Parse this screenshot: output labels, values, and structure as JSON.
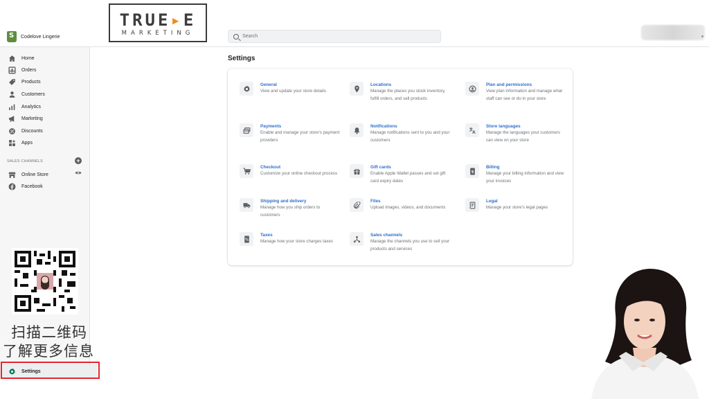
{
  "store": {
    "name": "Codelove Lingerie"
  },
  "brand": {
    "main_a": "TRUE",
    "main_b": "E",
    "sub": "MARKETING"
  },
  "search": {
    "placeholder": "Search"
  },
  "sidebar": {
    "items": [
      {
        "label": "Home",
        "icon": "home-icon"
      },
      {
        "label": "Orders",
        "icon": "orders-icon"
      },
      {
        "label": "Products",
        "icon": "tag-icon"
      },
      {
        "label": "Customers",
        "icon": "person-icon"
      },
      {
        "label": "Analytics",
        "icon": "bar-chart-icon"
      },
      {
        "label": "Marketing",
        "icon": "megaphone-icon"
      },
      {
        "label": "Discounts",
        "icon": "discount-icon"
      },
      {
        "label": "Apps",
        "icon": "apps-icon"
      }
    ],
    "section_label": "SALES CHANNELS",
    "channels": [
      {
        "label": "Online Store",
        "icon": "store-icon"
      },
      {
        "label": "Facebook",
        "icon": "facebook-icon"
      }
    ],
    "settings_label": "Settings"
  },
  "qr": {
    "line1": "扫描二维码",
    "line2": "了解更多信息"
  },
  "main": {
    "title": "Settings",
    "settings": [
      {
        "title": "General",
        "desc": "View and update your store details",
        "icon": "gear-icon"
      },
      {
        "title": "Locations",
        "desc": "Manage the places you stock inventory, fulfill orders, and sell products",
        "icon": "location-pin-icon"
      },
      {
        "title": "Plan and permissions",
        "desc": "View plan information and manage what staff can see or do in your store",
        "icon": "account-icon"
      },
      {
        "title": "Payments",
        "desc": "Enable and manage your store's payment providers",
        "icon": "payment-card-icon"
      },
      {
        "title": "Notifications",
        "desc": "Manage notifications sent to you and your customers",
        "icon": "bell-icon"
      },
      {
        "title": "Store languages",
        "desc": "Manage the languages your customers can view on your store",
        "icon": "translate-icon"
      },
      {
        "title": "Checkout",
        "desc": "Customize your online checkout process",
        "icon": "cart-icon"
      },
      {
        "title": "Gift cards",
        "desc": "Enable Apple Wallet passes and set gift card expiry dates",
        "icon": "gift-icon"
      },
      {
        "title": "Billing",
        "desc": "Manage your billing information and view your invoices",
        "icon": "billing-icon"
      },
      {
        "title": "Shipping and delivery",
        "desc": "Manage how you ship orders to customers",
        "icon": "truck-icon"
      },
      {
        "title": "Files",
        "desc": "Upload images, videos, and documents",
        "icon": "paperclip-icon"
      },
      {
        "title": "Legal",
        "desc": "Manage your store's legal pages",
        "icon": "legal-icon"
      },
      {
        "title": "Taxes",
        "desc": "Manage how your store charges taxes",
        "icon": "taxes-icon"
      },
      {
        "title": "Sales channels",
        "desc": "Manage the channels you use to sell your products and services",
        "icon": "channels-icon"
      }
    ]
  },
  "colors": {
    "link": "#2c6ecb",
    "highlight": "#e3262b",
    "sidebar_bg": "#f6f6f7",
    "brand_accent": "#f08a24"
  }
}
